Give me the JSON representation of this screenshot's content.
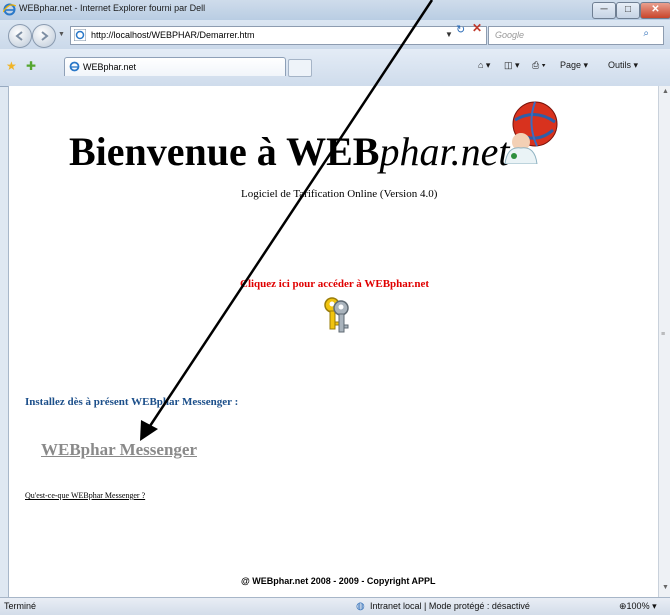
{
  "window": {
    "title": "WEBphar.net - Internet Explorer fourni par Dell",
    "min": "─",
    "max": "□",
    "close": "✕"
  },
  "address_bar": {
    "url": "http://localhost/WEBPHAR/Demarrer.htm",
    "search_placeholder": "Google"
  },
  "tab": {
    "label": "WEBphar.net"
  },
  "command_bar": {
    "page": "Page ▾",
    "tools": "Outils ▾"
  },
  "page": {
    "welcome_prefix": "Bienvenue à WEB",
    "welcome_suffix": "phar.net",
    "subtitle": "Logiciel de Tarification Online (Version 4.0)",
    "access_link": "Cliquez ici pour accéder à WEBphar.net",
    "install_heading": "Installez dès à présent WEBphar Messenger :",
    "messenger_link": "WEBphar Messenger",
    "what_is_link": "Qu'est-ce-que WEBphar Messenger ?",
    "copyright": "@ WEBphar.net 2008 - 2009 - Copyright APPL"
  },
  "status_bar": {
    "status": "Terminé",
    "zone": "Intranet local | Mode protégé : désactivé",
    "zoom": "100%"
  }
}
